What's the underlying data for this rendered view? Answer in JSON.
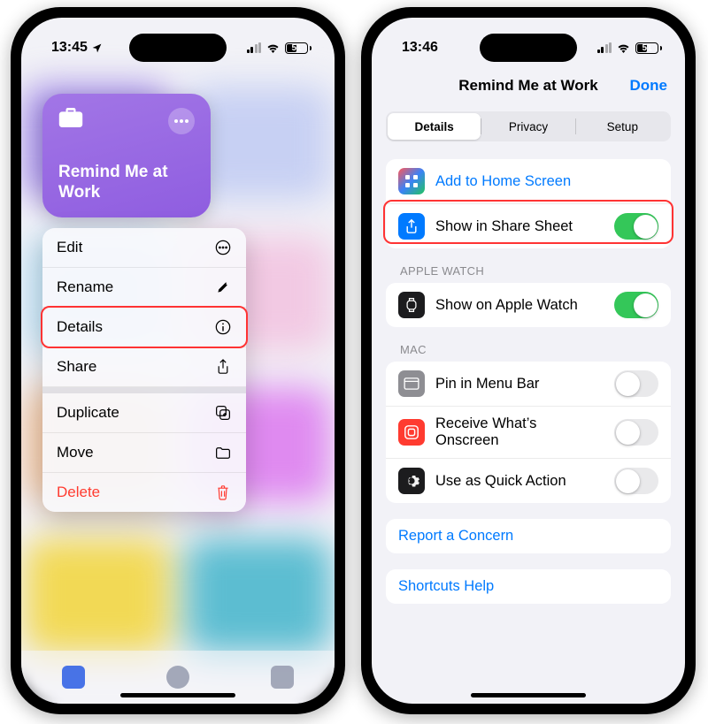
{
  "left": {
    "time": "13:45",
    "battery": "51",
    "shortcut_title": "Remind Me at Work",
    "menu": {
      "edit": "Edit",
      "rename": "Rename",
      "details": "Details",
      "share": "Share",
      "duplicate": "Duplicate",
      "move": "Move",
      "delete": "Delete"
    }
  },
  "right": {
    "time": "13:46",
    "battery": "51",
    "title": "Remind Me at Work",
    "done": "Done",
    "tabs": {
      "details": "Details",
      "privacy": "Privacy",
      "setup": "Setup"
    },
    "add_home": "Add to Home Screen",
    "share_sheet": "Show in Share Sheet",
    "section_watch": "Apple Watch",
    "show_watch": "Show on Apple Watch",
    "section_mac": "Mac",
    "pin_menu": "Pin in Menu Bar",
    "receive_onscreen": "Receive What’s Onscreen",
    "quick_action": "Use as Quick Action",
    "report": "Report a Concern",
    "help": "Shortcuts Help",
    "toggles": {
      "share_sheet": true,
      "watch": true,
      "pin": false,
      "receive": false,
      "quick": false
    }
  }
}
